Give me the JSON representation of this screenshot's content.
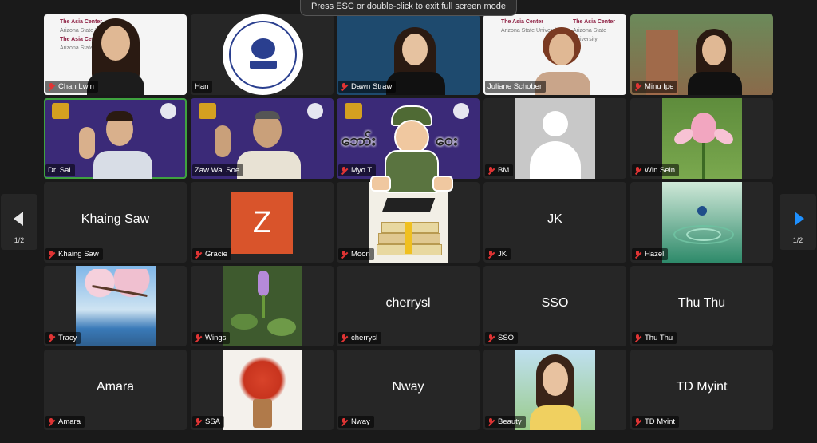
{
  "banner": "Press ESC or double-click to exit full screen mode",
  "pager": {
    "left": "1/2",
    "right": "1/2"
  },
  "tiles": [
    {
      "name": "Chan Lwin"
    },
    {
      "name": "Han"
    },
    {
      "name": "Dawn Straw"
    },
    {
      "name": "Juliane Schober"
    },
    {
      "name": "Minu Ipe"
    },
    {
      "name": "Dr. Sai"
    },
    {
      "name": "Zaw Wai Soe"
    },
    {
      "name": "Myo T"
    },
    {
      "name": "BM"
    },
    {
      "name": "Win Sein"
    },
    {
      "name": "Khaing Saw",
      "center": "Khaing Saw"
    },
    {
      "name": "Gracie",
      "avatar": "Z"
    },
    {
      "name": "Moon"
    },
    {
      "name": "JK",
      "center": "JK"
    },
    {
      "name": "Hazel"
    },
    {
      "name": "Tracy"
    },
    {
      "name": "Wings"
    },
    {
      "name": "cherrysl",
      "center": "cherrysl"
    },
    {
      "name": "SSO",
      "center": "SSO"
    },
    {
      "name": "Thu Thu",
      "center": "Thu Thu"
    },
    {
      "name": "Amara",
      "center": "Amara"
    },
    {
      "name": "SSA"
    },
    {
      "name": "Nway",
      "center": "Nway"
    },
    {
      "name": "Beauty"
    },
    {
      "name": "TD Myint",
      "center": "TD Myint"
    }
  ],
  "backdrop": {
    "line1": "The Asia Center",
    "line2": "Arizona State University"
  },
  "sticker_text": {
    "left": "ဘော်း",
    "right": "ဝေး"
  },
  "logo_text": "NATIONAL UNITY GOVERNMENT OF MYANMAR · MINISTRY OF EDUCATION",
  "colors": {
    "active_border": "#3fa23f",
    "mic_muted": "#e03434",
    "nav_arrow": "#1e90ff",
    "zoom_avatar": "#d9542b",
    "purple_bg": "#3b2a78"
  }
}
